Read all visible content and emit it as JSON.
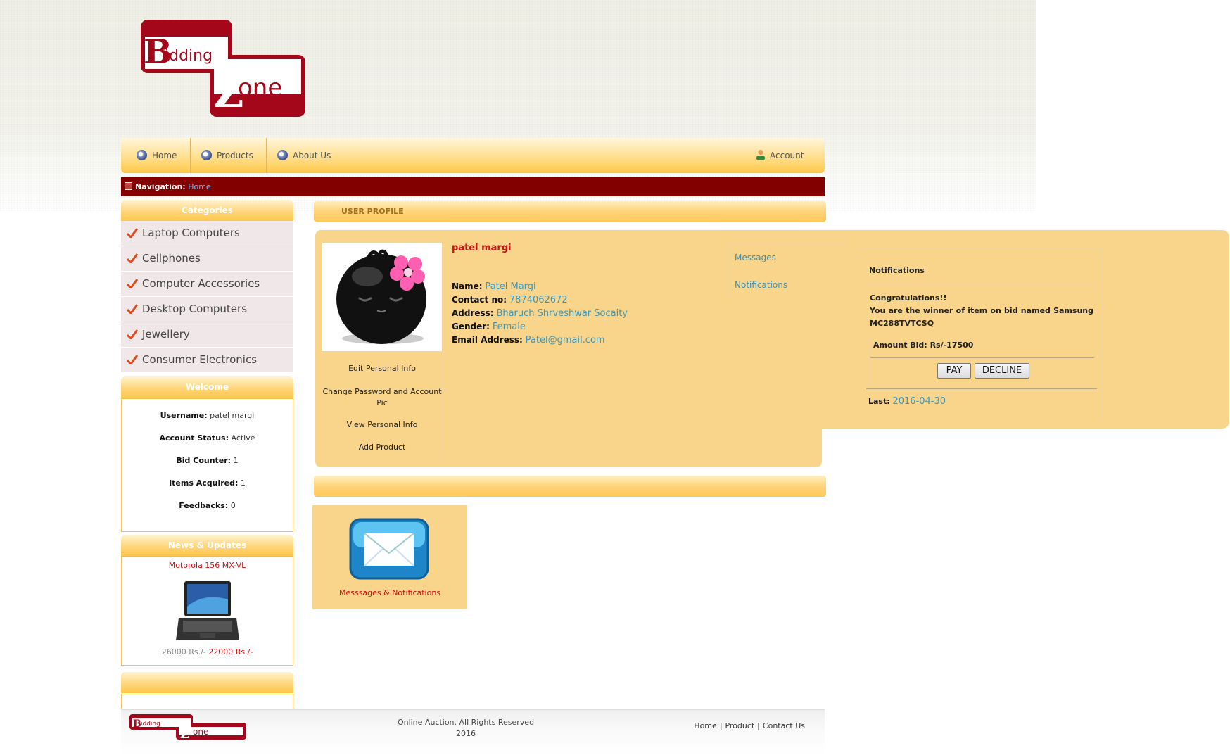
{
  "brand": {
    "logo_text": "Bidding Zone"
  },
  "nav": {
    "home": "Home",
    "products": "Products",
    "about": "About Us",
    "account": "Account"
  },
  "breadcrumb": {
    "label": "Navigation:",
    "current": "Home"
  },
  "sidebar": {
    "categories_title": "Categories",
    "categories": [
      "Laptop Computers",
      "Cellphones",
      "Computer Accessories",
      "Desktop Computers",
      "Jewellery",
      "Consumer Electronics"
    ],
    "welcome_title": "Welcome",
    "welcome": {
      "username_label": "Username:",
      "username": "patel margi",
      "status_label": "Account Status:",
      "status": "Active",
      "bid_label": "Bid Counter:",
      "bid": "1",
      "items_label": "Items Acquired:",
      "items": "1",
      "feedback_label": "Feedbacks:",
      "feedback": "0"
    },
    "news_title": "News & Updates",
    "news": {
      "item_name": "Motorola 156 MX-VL",
      "old_price": "26000 Rs./-",
      "new_price": "22000 Rs./-"
    }
  },
  "profile": {
    "section_title": "USER PROFILE",
    "display_name": "patel margi",
    "links": [
      "Edit Personal Info",
      "Change Password and Account Pic",
      "View Personal Info",
      "Add Product"
    ],
    "name_label": "Name:",
    "name": "Patel Margi",
    "contact_label": "Contact no:",
    "contact": "7874062672",
    "address_label": "Address:",
    "address": "Bharuch Shrveshwar Socaity",
    "gender_label": "Gender:",
    "gender": "Female",
    "email_label": "Email Address:",
    "email": "Patel@gmail.com"
  },
  "message_menu": [
    "Messages",
    "Notifications"
  ],
  "notification": {
    "title": "Notifications",
    "message_line1": "Congratulations!!",
    "message_line2": "You are the winner of item on bid named Samsung MC288TVTCSQ",
    "amount_label": "Amount Bid:",
    "amount": "Rs/-17500",
    "pay_label": "PAY",
    "decline_label": "DECLINE",
    "last_label": "Last:",
    "last_date": "2016-04-30"
  },
  "messages_tile": {
    "label": "Messsages & Notifications"
  },
  "footer": {
    "copyright_line1": "Online Auction. All Rights Reserved",
    "copyright_line2": "2016",
    "links": [
      "Home",
      "Product",
      "Contact Us"
    ]
  },
  "colors": {
    "brand_red": "#820000",
    "accent_orange": "#ffc84a",
    "panel": "#f9d58b",
    "link_blue": "#3f95b5",
    "alert_red": "#cc1111"
  }
}
